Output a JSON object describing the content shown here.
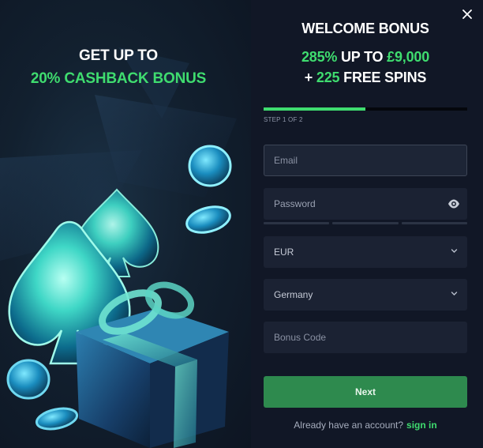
{
  "promo": {
    "line1": "GET UP TO",
    "line2": "20% CASHBACK BONUS"
  },
  "welcome": {
    "title": "WELCOME BONUS",
    "percent": "285%",
    "up_to": " UP TO ",
    "amount": "£9,000",
    "plus": "+ ",
    "spins_count": "225",
    "spins_label": " FREE SPINS"
  },
  "progress": {
    "step_text": "STEP 1 OF 2",
    "fraction": 0.5,
    "fill_color": "#3fdc6f"
  },
  "form": {
    "email_placeholder": "Email",
    "password_placeholder": "Password",
    "currency_value": "EUR",
    "country_value": "Germany",
    "bonus_code_placeholder": "Bonus Code",
    "next_label": "Next",
    "account_prompt": "Already have an account?",
    "signin_label": "sign in"
  },
  "icons": {
    "close": "close-icon",
    "eye": "eye-icon",
    "chevron": "chevron-down-icon"
  },
  "colors": {
    "accent": "#3fdc6f",
    "button": "#2e8a4e",
    "background": "#111726",
    "field": "#1b2233"
  }
}
